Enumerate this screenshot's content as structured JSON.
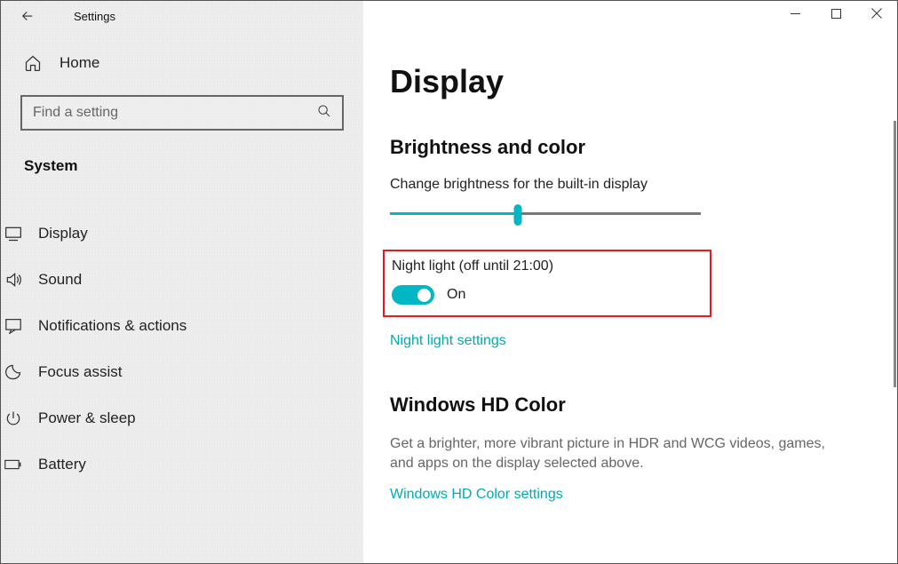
{
  "accent": "#00B7C3",
  "titlebar": {
    "app_name": "Settings"
  },
  "sidebar": {
    "home_label": "Home",
    "search_placeholder": "Find a setting",
    "section_label": "System",
    "items": [
      {
        "label": "Display",
        "active": true
      },
      {
        "label": "Sound"
      },
      {
        "label": "Notifications & actions"
      },
      {
        "label": "Focus assist"
      },
      {
        "label": "Power & sleep"
      },
      {
        "label": "Battery"
      }
    ]
  },
  "content": {
    "title": "Display",
    "brightness": {
      "heading": "Brightness and color",
      "label": "Change brightness for the built-in display",
      "value_percent": 41
    },
    "night_light": {
      "label": "Night light (off until 21:00)",
      "state_label": "On",
      "link": "Night light settings"
    },
    "hd_color": {
      "heading": "Windows HD Color",
      "description": "Get a brighter, more vibrant picture in HDR and WCG videos, games, and apps on the display selected above.",
      "link": "Windows HD Color settings"
    }
  }
}
